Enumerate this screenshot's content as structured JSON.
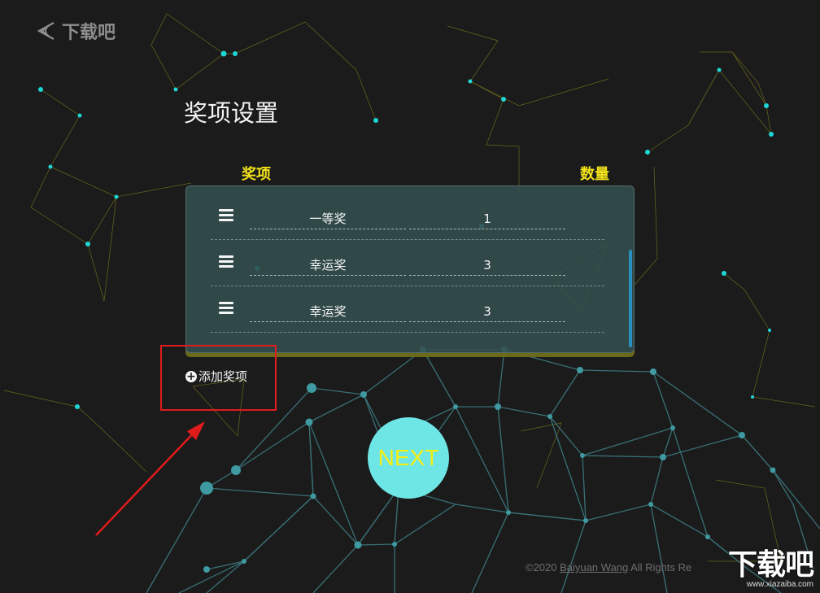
{
  "header": {
    "logo_text": "下载吧"
  },
  "page": {
    "title": "奖项设置"
  },
  "table": {
    "col_prize": "奖项",
    "col_count": "数量",
    "rows": [
      {
        "name": "一等奖",
        "count": "1"
      },
      {
        "name": "幸运奖",
        "count": "3"
      },
      {
        "name": "幸运奖",
        "count": "3"
      }
    ]
  },
  "actions": {
    "add_label": "添加奖项",
    "next_label": "NEXT"
  },
  "footer": {
    "copyright_prefix": "©2020 ",
    "author": "Baiyuan Wang",
    "rights": " All Rights Re"
  },
  "watermark": {
    "main": "下载吧",
    "url": "www.xiazaiba.com"
  },
  "colors": {
    "accent_yellow": "#f3e21b",
    "next_bg": "#6fe6e6",
    "highlight": "#e01b1b",
    "scrollbar": "#2a8fbf"
  }
}
